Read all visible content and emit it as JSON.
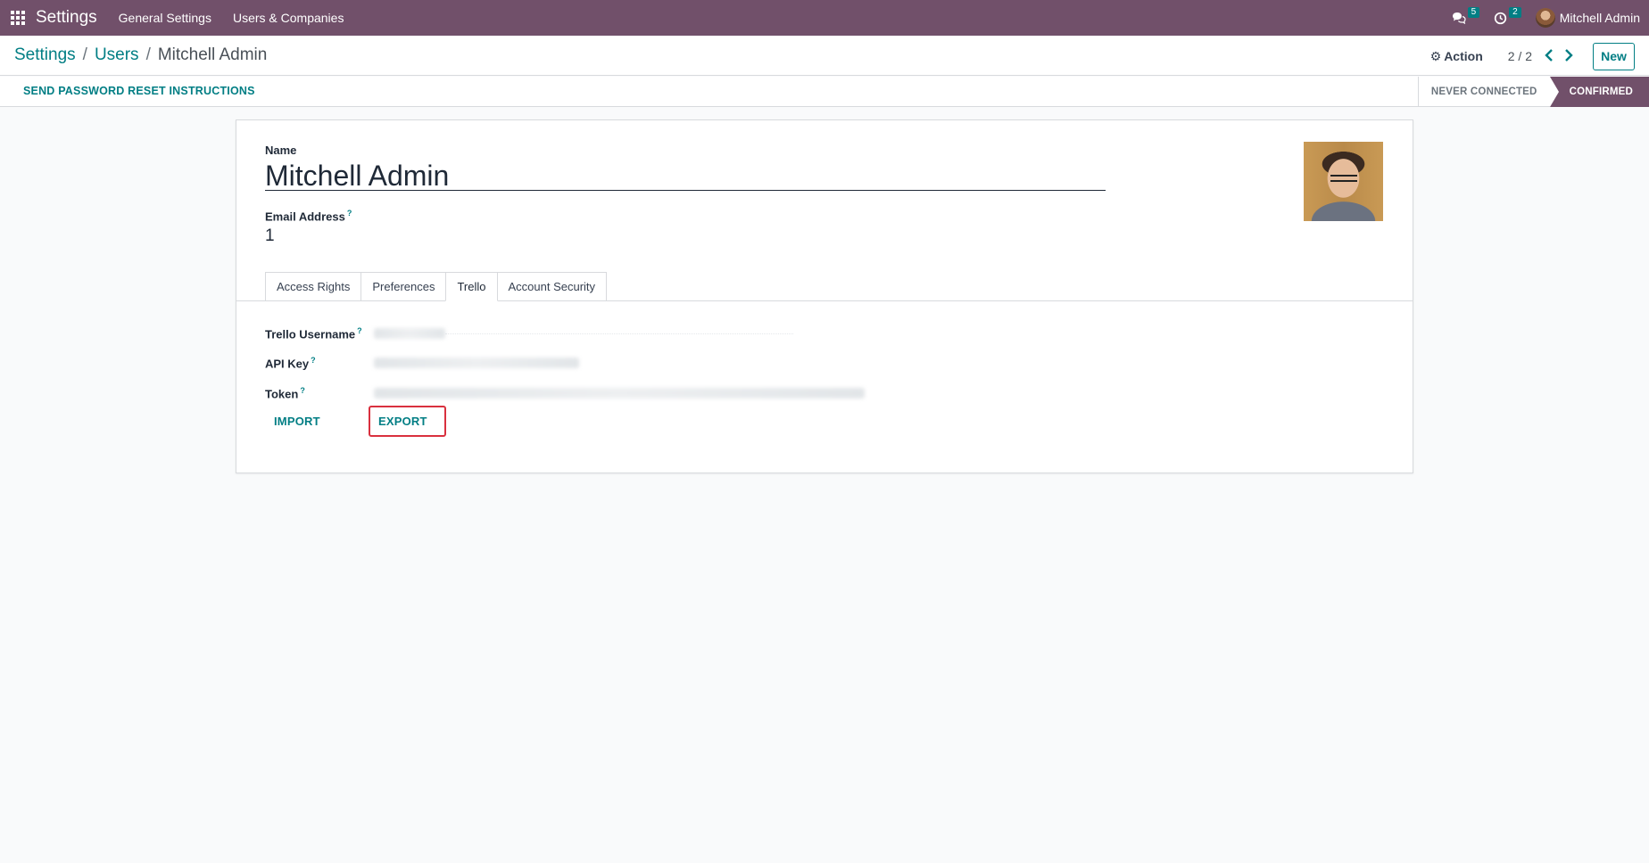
{
  "navbar": {
    "brand": "Settings",
    "menu": [
      "General Settings",
      "Users & Companies"
    ],
    "messages_count": "5",
    "activities_count": "2",
    "user_name": "Mitchell Admin"
  },
  "breadcrumb": {
    "items": [
      "Settings",
      "Users"
    ],
    "current": "Mitchell Admin",
    "separator": "/"
  },
  "control": {
    "action_label": "Action",
    "pager": "2 / 2",
    "new_label": "New"
  },
  "statusbar": {
    "reset_label": "SEND PASSWORD RESET INSTRUCTIONS",
    "steps": [
      "NEVER CONNECTED",
      "CONFIRMED"
    ],
    "current_step": "CONFIRMED"
  },
  "form": {
    "name_label": "Name",
    "name_value": "Mitchell Admin",
    "email_label": "Email Address",
    "email_value": "1",
    "help_mark": "?",
    "tabs": [
      "Access Rights",
      "Preferences",
      "Trello",
      "Account Security"
    ],
    "active_tab": "Trello",
    "trello": {
      "username_label": "Trello Username",
      "api_key_label": "API Key",
      "token_label": "Token",
      "import_label": "IMPORT",
      "export_label": "EXPORT"
    }
  },
  "colors": {
    "navbar": "#71506a",
    "accent": "#017e84",
    "highlight": "#d9303e"
  }
}
